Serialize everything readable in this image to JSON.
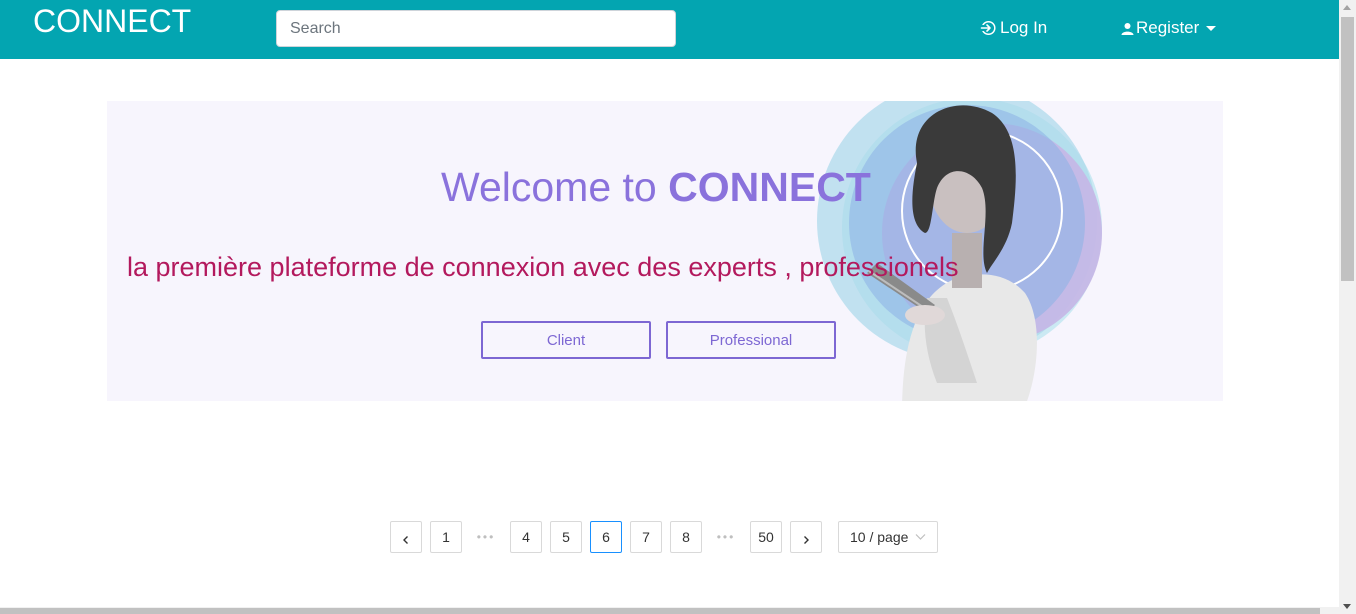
{
  "navbar": {
    "brand": "CONNECT",
    "search_placeholder": "Search",
    "login_label": "Log In",
    "register_label": "Register",
    "login_icon": "sign-in-icon",
    "register_icon": "user-icon"
  },
  "hero": {
    "welcome_prefix": "Welcome to",
    "welcome_brand": "CONNECT",
    "tagline": "la première plateforme de connexion avec des experts , professionels",
    "client_button": "Client",
    "professional_button": "Professional"
  },
  "pagination": {
    "prev_label": "<",
    "next_label": ">",
    "ellipsis": "•••",
    "pages": {
      "p1": "1",
      "p4": "4",
      "p5": "5",
      "p6": "6",
      "p7": "7",
      "p8": "8",
      "p50": "50"
    },
    "current_page": "6",
    "page_size": "10 / page"
  },
  "colors": {
    "navbar": "#03a5b1",
    "welcome": "#8a72dc",
    "tagline": "#b3195d",
    "hero_bg": "#f7f5fd",
    "active_page_border": "#1890ff"
  }
}
